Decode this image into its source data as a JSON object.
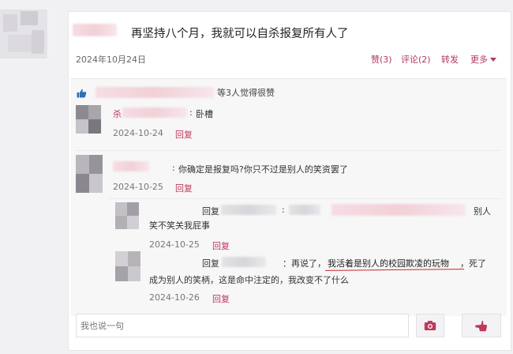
{
  "status": {
    "text": "再坚持八个月，我就可以自杀报复所有人了",
    "date": "2024年10月24日",
    "actions": {
      "praise": "赞(3)",
      "comment": "评论(2)",
      "forward": "转发",
      "more": "更多"
    }
  },
  "likes": {
    "text": "等3人觉得很赞"
  },
  "comments": [
    {
      "name_prefix": "杀",
      "text": "卧槽",
      "date": "2024-10-24",
      "reply_label": "回复"
    },
    {
      "text": "你确定是报复吗?你只不过是别人的笑资罢了",
      "date": "2024-10-25",
      "reply_label": "回复"
    }
  ],
  "replies": [
    {
      "prefix": "回复",
      "colon": ":",
      "tail": "别人",
      "text_line2": "笑不笑关我屁事",
      "date": "2024-10-25",
      "reply_label": "回复"
    },
    {
      "prefix": "回复",
      "text_part1": "：再说了，",
      "text_highlight": "我活着是别人的校园欺凌的玩物",
      "text_part2": "，死了",
      "text_line2": "成为别人的笑柄，这是命中注定的，我改变不了什么",
      "date": "2024-10-26",
      "reply_label": "回复"
    }
  ],
  "input": {
    "placeholder": "我也说一句"
  },
  "icons": [
    "like-thumb-icon",
    "camera-icon",
    "pointing-hand-icon",
    "chevron-down-icon"
  ],
  "colors": {
    "accent": "#c0395b",
    "highlight": "#c8262c"
  }
}
